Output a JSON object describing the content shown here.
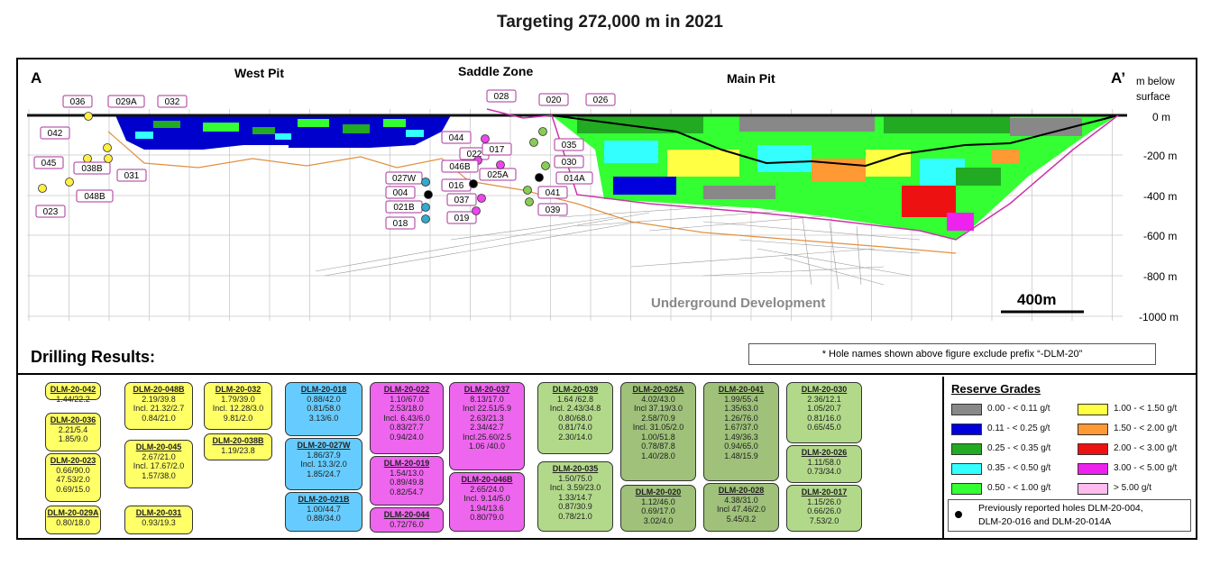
{
  "title": "Targeting 272,000 m in 2021",
  "diagram": {
    "section_start": "A",
    "section_end": "A’",
    "zones": [
      "West Pit",
      "Saddle Zone",
      "Main Pit"
    ],
    "depth_axis_label_1": "m below",
    "depth_axis_label_2": "surface",
    "depth_ticks": [
      "0 m",
      "-200 m",
      "-400 m",
      "-600 m",
      "-800 m",
      "-1000 m"
    ],
    "underground_label": "Underground Development",
    "scale_bar_label": "400m",
    "hole_labels": [
      "036",
      "029A",
      "032",
      "042",
      "045",
      "038B",
      "031",
      "048B",
      "023",
      "028",
      "020",
      "026",
      "044",
      "022",
      "017",
      "035",
      "030",
      "025A",
      "014A",
      "046B",
      "027W",
      "016",
      "004",
      "037",
      "041",
      "021B",
      "039",
      "018",
      "019"
    ]
  },
  "drilling_title": "Drilling Results:",
  "footnote": "* Hole names shown above figure exclude prefix “-DLM-20”",
  "results": [
    {
      "name": "DLM-20-042",
      "lines": [
        "1.44/22.2"
      ],
      "color": "#ffff66"
    },
    {
      "name": "DLM-20-036",
      "lines": [
        "2.21/5.4",
        "1.85/9.0"
      ],
      "color": "#ffff66"
    },
    {
      "name": "DLM-20-023",
      "lines": [
        "0.66/90.0",
        "47.53/2.0",
        "0.69/15.0"
      ],
      "color": "#ffff66"
    },
    {
      "name": "DLM-20-029A",
      "lines": [
        "0.80/18.0"
      ],
      "color": "#ffff66"
    },
    {
      "name": "DLM-20-048B",
      "lines": [
        "2.19/39.8",
        "Incl. 21.32/2.7",
        "0.84/21.0"
      ],
      "color": "#ffff66"
    },
    {
      "name": "DLM-20-045",
      "lines": [
        "2.67/21.0",
        "Incl. 17.67/2.0",
        "1.57/38.0"
      ],
      "color": "#ffff66"
    },
    {
      "name": "DLM-20-031",
      "lines": [
        "0.93/19.3"
      ],
      "color": "#ffff66"
    },
    {
      "name": "DLM-20-032",
      "lines": [
        "1.79/39.0",
        "Incl. 12.28/3.0",
        "9.81/2.0"
      ],
      "color": "#ffff66"
    },
    {
      "name": "DLM-20-038B",
      "lines": [
        "1.19/23.8"
      ],
      "color": "#ffff66"
    },
    {
      "name": "DLM-20-018",
      "lines": [
        "0.88/42.0",
        "0.81/58.0",
        "3.13/6.0"
      ],
      "color": "#66ccff"
    },
    {
      "name": "DLM-20-027W",
      "lines": [
        "1.86/37.9",
        "Incl. 13.3/2.0",
        "1.85/24.7"
      ],
      "color": "#66ccff"
    },
    {
      "name": "DLM-20-021B",
      "lines": [
        "1.00/44.7",
        "0.88/34.0"
      ],
      "color": "#66ccff"
    },
    {
      "name": "DLM-20-022",
      "lines": [
        "1.10/67.0",
        "2.53/18.0",
        "Incl. 6.43/6.0",
        "0.83/27.7",
        "0.94/24.0"
      ],
      "color": "#ee66ee"
    },
    {
      "name": "DLM-20-019",
      "lines": [
        "1.54/13.0",
        "0.89/49.8",
        "0.82/54.7"
      ],
      "color": "#ee66ee"
    },
    {
      "name": "DLM-20-044",
      "lines": [
        "0.72/76.0"
      ],
      "color": "#ee66ee"
    },
    {
      "name": "DLM-20-037",
      "lines": [
        "8.13/17.0",
        "Incl 22.51/5.9",
        "2.63/21.3",
        "2.34/42.7",
        "Incl.25.60/2.5",
        "1.06 /40.0"
      ],
      "color": "#ee66ee"
    },
    {
      "name": "DLM-20-046B",
      "lines": [
        "2.65/24.0",
        "Incl. 9.14/5.0",
        "1.94/13.6",
        "0.80/79.0"
      ],
      "color": "#ee66ee"
    },
    {
      "name": "DLM-20-039",
      "lines": [
        "1.64 /62.8",
        "Incl. 2.43/34.8",
        "0.80/68.0",
        "0.81/74.0",
        "2.30/14.0"
      ],
      "color": "#b2d98a"
    },
    {
      "name": "DLM-20-035",
      "lines": [
        "1.50/75.0",
        "Incl. 3.59/23.0",
        "1.33/14.7",
        "0.87/30.9",
        "0.78/21.0"
      ],
      "color": "#b2d98a"
    },
    {
      "name": "DLM-20-025A",
      "lines": [
        "4.02/43.0",
        "Incl 37.19/3.0",
        "2.58/70.9",
        "Incl. 31.05/2.0",
        "1.00/51.8",
        "0.78/87.8",
        "1.40/28.0"
      ],
      "color": "#9fc17a"
    },
    {
      "name": "DLM-20-020",
      "lines": [
        "1.12/46.0",
        "0.69/17.0",
        "3.02/4.0"
      ],
      "color": "#9fc17a"
    },
    {
      "name": "DLM-20-041",
      "lines": [
        "1.99/55.4",
        "1.35/63.0",
        "1.26/76.0",
        "1.67/37.0",
        "1.49/36.3",
        "0.94/65.0",
        "1.48/15.9"
      ],
      "color": "#9fc17a"
    },
    {
      "name": "DLM-20-028",
      "lines": [
        "4.38/31.0",
        "Incl 47.46/2.0",
        "5.45/3.2"
      ],
      "color": "#9fc17a"
    },
    {
      "name": "DLM-20-030",
      "lines": [
        "2.36/12.1",
        "1.05/20.7",
        "0.81/16.0",
        "0.65/45.0"
      ],
      "color": "#b2d98a"
    },
    {
      "name": "DLM-20-026",
      "lines": [
        "1.11/58.0",
        "0.73/34.0"
      ],
      "color": "#b2d98a"
    },
    {
      "name": "DLM-20-017",
      "lines": [
        "1.15/26.0",
        "0.66/26.0",
        "7.53/2.0"
      ],
      "color": "#b2d98a"
    }
  ],
  "legend": {
    "title": "Reserve Grades",
    "grades": [
      {
        "label": "0.00 - < 0.11 g/t",
        "color": "#888888"
      },
      {
        "label": "0.11 - < 0.25 g/t",
        "color": "#0000dd"
      },
      {
        "label": "0.25 - < 0.35 g/t",
        "color": "#22aa22"
      },
      {
        "label": "0.35 - < 0.50 g/t",
        "color": "#33ffff"
      },
      {
        "label": "0.50 - < 1.00 g/t",
        "color": "#33ff33"
      },
      {
        "label": "1.00 - < 1.50 g/t",
        "color": "#ffff44"
      },
      {
        "label": "1.50 - < 2.00 g/t",
        "color": "#ff9933"
      },
      {
        "label": "2.00 - < 3.00 g/t",
        "color": "#ee1111"
      },
      {
        "label": "3.00 - < 5.00 g/t",
        "color": "#ee22ee"
      },
      {
        "label": "> 5.00 g/t",
        "color": "#ffbbee"
      }
    ],
    "note_1": "Previously reported holes DLM-20-004,",
    "note_2": "DLM-20-016 and DLM-20-014A"
  }
}
